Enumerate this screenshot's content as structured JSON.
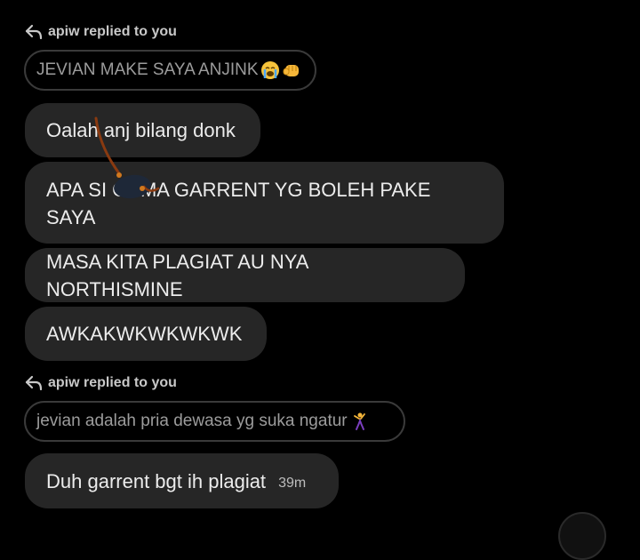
{
  "replies": [
    {
      "header": "apiw replied to you",
      "quote": "JEVIAN MAKE SAYA ANJINK",
      "quote_emojis": [
        "crying-face",
        "fist-bump"
      ]
    },
    {
      "header": "apiw replied to you",
      "quote": "jevian adalah pria dewasa yg suka ngatur",
      "quote_emojis": [
        "dancing-man"
      ]
    }
  ],
  "messages": [
    {
      "text": "Oalah anj bilang donk"
    },
    {
      "text": "APA SI CUMA GARRENT YG BOLEH PAKE SAYA"
    },
    {
      "text": "MASA KITA PLAGIAT AU NYA NORTHISMINE"
    },
    {
      "text": "AWKAKWKWKWKWK"
    },
    {
      "text": "Duh garrent bgt ih plagiat",
      "time": "39m"
    }
  ],
  "colors": {
    "background": "#000000",
    "bubble": "#262626",
    "text": "#ececec"
  }
}
